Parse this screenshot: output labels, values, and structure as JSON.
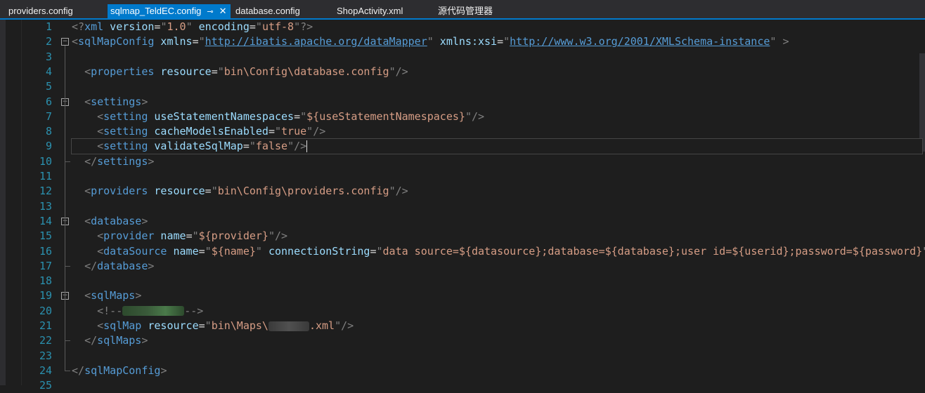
{
  "tabs": [
    {
      "label": "providers.config",
      "active": false
    },
    {
      "label": "sqlmap_TeldEC.config",
      "active": true
    },
    {
      "label": "database.config",
      "active": false
    },
    {
      "label": "ShopActivity.xml",
      "active": false
    },
    {
      "label": "源代码管理器",
      "active": false
    }
  ],
  "tab_icons": {
    "pin": "pin-icon",
    "close": "close-icon"
  },
  "colors": {
    "accent": "#007acc",
    "background": "#1e1e1e",
    "line_number": "#2b91af",
    "tag": "#569cd6",
    "attribute": "#9cdcfe",
    "value": "#d69d85",
    "comment": "#57a64a"
  },
  "editor": {
    "current_line": 9,
    "lines": [
      {
        "n": "1",
        "seg": [
          [
            "b",
            "<?"
          ],
          [
            "t",
            "xml"
          ],
          [
            "a",
            " version"
          ],
          [
            "q",
            "="
          ],
          [
            "b",
            "\""
          ],
          [
            "v",
            "1.0"
          ],
          [
            "b",
            "\""
          ],
          [
            "a",
            " encoding"
          ],
          [
            "q",
            "="
          ],
          [
            "b",
            "\""
          ],
          [
            "v",
            "utf-8"
          ],
          [
            "b",
            "\""
          ],
          [
            "b",
            "?>"
          ]
        ]
      },
      {
        "n": "2",
        "seg": [
          [
            "b",
            "<"
          ],
          [
            "t",
            "sqlMapConfig"
          ],
          [
            "a",
            " xmlns"
          ],
          [
            "q",
            "="
          ],
          [
            "b",
            "\""
          ],
          [
            "u",
            "http://ibatis.apache.org/dataMapper"
          ],
          [
            "b",
            "\""
          ],
          [
            "a",
            " xmlns:xsi"
          ],
          [
            "q",
            "="
          ],
          [
            "b",
            "\""
          ],
          [
            "u",
            "http://www.w3.org/2001/XMLSchema-instance"
          ],
          [
            "b",
            "\""
          ],
          [
            "b",
            " >"
          ]
        ]
      },
      {
        "n": "3",
        "seg": []
      },
      {
        "n": "4",
        "seg": [
          [
            "q",
            "  "
          ],
          [
            "b",
            "<"
          ],
          [
            "t",
            "properties"
          ],
          [
            "a",
            " resource"
          ],
          [
            "q",
            "="
          ],
          [
            "b",
            "\""
          ],
          [
            "v",
            "bin\\Config\\database.config"
          ],
          [
            "b",
            "\""
          ],
          [
            "b",
            "/>"
          ]
        ]
      },
      {
        "n": "5",
        "seg": []
      },
      {
        "n": "6",
        "seg": [
          [
            "q",
            "  "
          ],
          [
            "b",
            "<"
          ],
          [
            "t",
            "settings"
          ],
          [
            "b",
            ">"
          ]
        ]
      },
      {
        "n": "7",
        "seg": [
          [
            "q",
            "    "
          ],
          [
            "b",
            "<"
          ],
          [
            "t",
            "setting"
          ],
          [
            "a",
            " useStatementNamespaces"
          ],
          [
            "q",
            "="
          ],
          [
            "b",
            "\""
          ],
          [
            "v",
            "${useStatementNamespaces}"
          ],
          [
            "b",
            "\""
          ],
          [
            "b",
            "/>"
          ]
        ]
      },
      {
        "n": "8",
        "seg": [
          [
            "q",
            "    "
          ],
          [
            "b",
            "<"
          ],
          [
            "t",
            "setting"
          ],
          [
            "a",
            " cacheModelsEnabled"
          ],
          [
            "q",
            "="
          ],
          [
            "b",
            "\""
          ],
          [
            "v",
            "true"
          ],
          [
            "b",
            "\""
          ],
          [
            "b",
            "/>"
          ]
        ]
      },
      {
        "n": "9",
        "seg": [
          [
            "q",
            "    "
          ],
          [
            "b",
            "<"
          ],
          [
            "t",
            "setting"
          ],
          [
            "a",
            " validateSqlMap"
          ],
          [
            "q",
            "="
          ],
          [
            "b",
            "\""
          ],
          [
            "v",
            "false"
          ],
          [
            "b",
            "\""
          ],
          [
            "b",
            "/>"
          ]
        ]
      },
      {
        "n": "10",
        "seg": [
          [
            "q",
            "  "
          ],
          [
            "b",
            "</"
          ],
          [
            "t",
            "settings"
          ],
          [
            "b",
            ">"
          ]
        ]
      },
      {
        "n": "11",
        "seg": []
      },
      {
        "n": "12",
        "seg": [
          [
            "q",
            "  "
          ],
          [
            "b",
            "<"
          ],
          [
            "t",
            "providers"
          ],
          [
            "a",
            " resource"
          ],
          [
            "q",
            "="
          ],
          [
            "b",
            "\""
          ],
          [
            "v",
            "bin\\Config\\providers.config"
          ],
          [
            "b",
            "\""
          ],
          [
            "b",
            "/>"
          ]
        ]
      },
      {
        "n": "13",
        "seg": []
      },
      {
        "n": "14",
        "seg": [
          [
            "q",
            "  "
          ],
          [
            "b",
            "<"
          ],
          [
            "t",
            "database"
          ],
          [
            "b",
            ">"
          ]
        ]
      },
      {
        "n": "15",
        "seg": [
          [
            "q",
            "    "
          ],
          [
            "b",
            "<"
          ],
          [
            "t",
            "provider"
          ],
          [
            "a",
            " name"
          ],
          [
            "q",
            "="
          ],
          [
            "b",
            "\""
          ],
          [
            "v",
            "${provider}"
          ],
          [
            "b",
            "\""
          ],
          [
            "b",
            "/>"
          ]
        ]
      },
      {
        "n": "16",
        "seg": [
          [
            "q",
            "    "
          ],
          [
            "b",
            "<"
          ],
          [
            "t",
            "dataSource"
          ],
          [
            "a",
            " name"
          ],
          [
            "q",
            "="
          ],
          [
            "b",
            "\""
          ],
          [
            "v",
            "${name}"
          ],
          [
            "b",
            "\""
          ],
          [
            "a",
            " connectionString"
          ],
          [
            "q",
            "="
          ],
          [
            "b",
            "\""
          ],
          [
            "v",
            "data source=${datasource};database=${database};user id=${userid};password=${password}"
          ],
          [
            "b",
            "\""
          ],
          [
            "b",
            "/>"
          ]
        ]
      },
      {
        "n": "17",
        "seg": [
          [
            "q",
            "  "
          ],
          [
            "b",
            "</"
          ],
          [
            "t",
            "database"
          ],
          [
            "b",
            ">"
          ]
        ]
      },
      {
        "n": "18",
        "seg": []
      },
      {
        "n": "19",
        "seg": [
          [
            "q",
            "  "
          ],
          [
            "b",
            "<"
          ],
          [
            "t",
            "sqlMaps"
          ],
          [
            "b",
            ">"
          ]
        ]
      },
      {
        "n": "20",
        "seg": [
          [
            "q",
            "    "
          ],
          [
            "b",
            "<!--"
          ],
          [
            "blurc",
            "redacted"
          ],
          [
            "b",
            "-->"
          ]
        ]
      },
      {
        "n": "21",
        "seg": [
          [
            "q",
            "    "
          ],
          [
            "b",
            "<"
          ],
          [
            "t",
            "sqlMap"
          ],
          [
            "a",
            " resource"
          ],
          [
            "q",
            "="
          ],
          [
            "b",
            "\""
          ],
          [
            "v",
            "bin\\Maps\\"
          ],
          [
            "blurv",
            "redacted"
          ],
          [
            "v",
            ".xml"
          ],
          [
            "b",
            "\""
          ],
          [
            "b",
            "/>"
          ]
        ]
      },
      {
        "n": "22",
        "seg": [
          [
            "q",
            "  "
          ],
          [
            "b",
            "</"
          ],
          [
            "t",
            "sqlMaps"
          ],
          [
            "b",
            ">"
          ]
        ]
      },
      {
        "n": "23",
        "seg": []
      },
      {
        "n": "24",
        "seg": [
          [
            "b",
            "</"
          ],
          [
            "t",
            "sqlMapConfig"
          ],
          [
            "b",
            ">"
          ]
        ]
      },
      {
        "n": "25",
        "seg": []
      }
    ]
  }
}
